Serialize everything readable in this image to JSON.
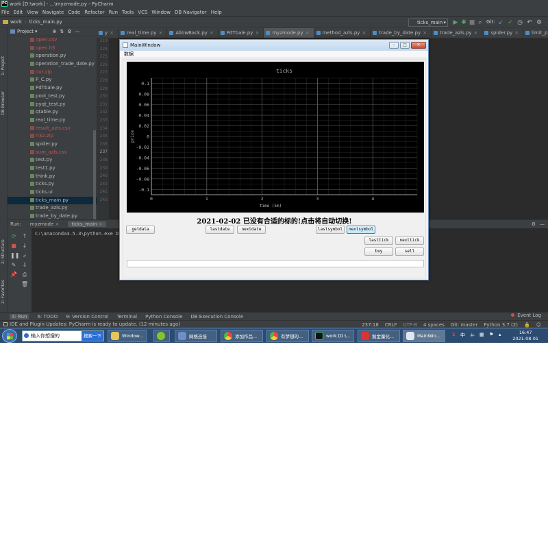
{
  "ide": {
    "window_title": "work [D:\\work] - ...\\myzmode.py - PyCharm",
    "menu": [
      "File",
      "Edit",
      "View",
      "Navigate",
      "Code",
      "Refactor",
      "Run",
      "Tools",
      "VCS",
      "Window",
      "DB Navigator",
      "Help"
    ],
    "breadcrumb": [
      "work",
      "ticks_main.py"
    ],
    "run_config": "ticks_main",
    "git_label": "Git:",
    "left_strip": [
      "1: Project",
      "DB Browser",
      "2: Structure",
      "2: Favorites"
    ],
    "project_title": "Project",
    "files": [
      {
        "name": "open.csv",
        "red": true
      },
      {
        "name": "open.h5",
        "red": true
      },
      {
        "name": "operation.py",
        "red": false
      },
      {
        "name": "operation_trade_date.py",
        "red": false
      },
      {
        "name": "out.zip",
        "red": true
      },
      {
        "name": "P_C.py",
        "red": false
      },
      {
        "name": "PdTbale.py",
        "red": false
      },
      {
        "name": "pool_test.py",
        "red": false
      },
      {
        "name": "pyqt_test.py",
        "red": false
      },
      {
        "name": "qtable.py",
        "red": false
      },
      {
        "name": "real_time.py",
        "red": false
      },
      {
        "name": "result_azls.csv",
        "red": true
      },
      {
        "name": "rl32.zip",
        "red": true
      },
      {
        "name": "spider.py",
        "red": false
      },
      {
        "name": "sum_azls.csv",
        "red": true
      },
      {
        "name": "test.py",
        "red": false
      },
      {
        "name": "test1.py",
        "red": false
      },
      {
        "name": "think.py",
        "red": false
      },
      {
        "name": "ticks.py",
        "red": false
      },
      {
        "name": "ticks.ui",
        "red": false
      },
      {
        "name": "ticks_main.py",
        "red": false,
        "selected": true
      },
      {
        "name": "trade_azls.py",
        "red": false
      },
      {
        "name": "trade_by_date.py",
        "red": false
      }
    ],
    "tabs": [
      {
        "label": "y",
        "active": false
      },
      {
        "label": "real_time.py",
        "active": false
      },
      {
        "label": "AllowBack.py",
        "active": false
      },
      {
        "label": "PdTbale.py",
        "active": false
      },
      {
        "label": "myzmode.py",
        "active": true
      },
      {
        "label": "method_azls.py",
        "active": false
      },
      {
        "label": "trade_by_date.py",
        "active": false
      },
      {
        "label": "trade_azls.py",
        "active": false
      },
      {
        "label": "spider.py",
        "active": false
      },
      {
        "label": "limit_process.py",
        "active": false
      }
    ],
    "line_numbers": [
      "219",
      "224",
      "225",
      "226",
      "227",
      "228",
      "229",
      "230",
      "231",
      "232",
      "233",
      "234",
      "235",
      "236",
      "237",
      "238",
      "239",
      "240",
      "241",
      "242",
      "243"
    ],
    "run": {
      "label": "Run:",
      "tabs": [
        "myzmode",
        "ticks_main"
      ],
      "console_line": "C:\\anaconda3.5.3\\python.exe D:/w"
    },
    "tool_tabs": [
      "4: Run",
      "6: TODO",
      "9: Version Control",
      "Terminal",
      "Python Console",
      "DB Execution Console"
    ],
    "event_log": "Event Log",
    "status": {
      "message": "IDE and Plugin Updates: PyCharm is ready to update. (12 minutes ago)",
      "position": "237:18",
      "line_sep": "CRLF",
      "encoding": "UTF-8",
      "indent": "4 spaces",
      "git": "Git: master",
      "interpreter": "Python 3.7 (2)"
    }
  },
  "taskbar": {
    "search_placeholder": "输入你想搜的",
    "search_button": "搜索一下",
    "tasks": [
      "Window...",
      "",
      "网络连接",
      "添加作品...",
      "有梦想的...",
      "work [D:\\...",
      "掘金量化...",
      "MainWin..."
    ],
    "time": "16:47",
    "date": "2021-08-01"
  },
  "mainwindow": {
    "title": "MainWindow",
    "menu": "数据",
    "headline": "2021-02-02 已没有合适的标的!点击将自动切换!",
    "buttons": {
      "getdata": "getdata",
      "lastdate": "lastdate",
      "nextdate": "nextdate",
      "lastsymbol": "lastsymbol",
      "nextsymbol": "nextsymbol",
      "lasttick": "lasttick",
      "nexttick": "nexttick",
      "buy": "buy",
      "sell": "sell"
    }
  },
  "chart_data": {
    "type": "line",
    "title": "ticks",
    "xlabel": "time (5m)",
    "ylabel": "price",
    "xlim": [
      0,
      4.8
    ],
    "ylim": [
      -0.11,
      0.11
    ],
    "xticks": [
      0,
      1,
      2,
      3,
      4
    ],
    "yticks": [
      0.1,
      0.08,
      0.06,
      0.04,
      0.02,
      0,
      -0.02,
      -0.04,
      -0.06,
      -0.08,
      -0.1
    ],
    "grid": true,
    "series": []
  }
}
